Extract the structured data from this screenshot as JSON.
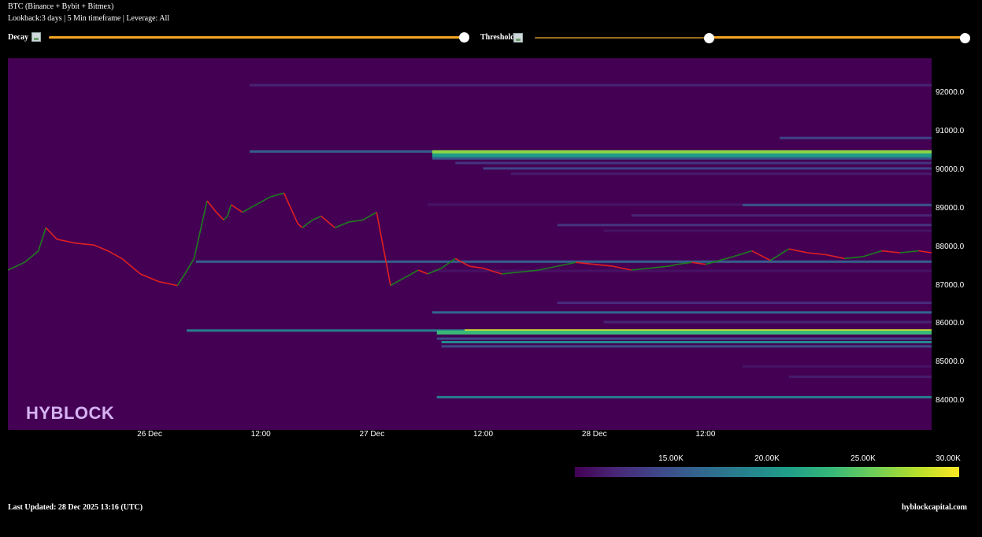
{
  "header": {
    "title": "BTC (Binance + Bybit + Bitmex)",
    "subtitle": "Lookback:3 days | 5 Min timeframe | Leverage: All"
  },
  "controls": {
    "decay": {
      "label": "Decay",
      "value": 1.0
    },
    "threshold": {
      "label": "Threshold",
      "range": [
        0.4,
        1.0
      ]
    }
  },
  "colors": {
    "background": "#000000",
    "heatmap_bg": "#440154",
    "slider": "#f5a623",
    "candle_up": "#1e7d1e",
    "candle_down": "#e02020"
  },
  "footer": {
    "updated": "Last Updated: 28 Dec 2025 13:16 (UTC)",
    "site": "hyblockcapital.com"
  },
  "watermark": "HYBLOCK",
  "chart_data": {
    "type": "heatmap",
    "title": "BTC (Binance + Bybit + Bitmex)",
    "x_ticks": [
      "26 Dec",
      "12:00",
      "27 Dec",
      "12:00",
      "28 Dec",
      "12:00"
    ],
    "y_ticks": [
      "92000.0",
      "91000.0",
      "90000.0",
      "89000.0",
      "88000.0",
      "87000.0",
      "86000.0",
      "85000.0",
      "84000.0"
    ],
    "ylim": [
      83250,
      92900
    ],
    "xlim_hours": [
      -39.3,
      60.4
    ],
    "colorbar": {
      "ticks": [
        "15.00K",
        "20.00K",
        "25.00K",
        "30.00K"
      ],
      "range": [
        10000,
        30000
      ]
    },
    "price_series": {
      "hours": [
        -39.3,
        -37.5,
        -36,
        -35.2,
        -34,
        -32,
        -30,
        -28.5,
        -27,
        -25,
        -23,
        -21,
        -20.2,
        -19.2,
        -17.8,
        -16.8,
        -16,
        -15.6,
        -15.2,
        -14,
        -12.5,
        -11,
        -9.5,
        -8,
        -7.5,
        -7,
        -6.4,
        -5.5,
        -4,
        -2.5,
        -1,
        0.5,
        2,
        3.5,
        5,
        6,
        7.5,
        9,
        10.5,
        12,
        14,
        16,
        18,
        20,
        22,
        24,
        26,
        28,
        30,
        32,
        33,
        34.5,
        36,
        37.5,
        39,
        41,
        43,
        45,
        47,
        49,
        51,
        53,
        55,
        57,
        59,
        60.4
      ],
      "values": [
        87400,
        87600,
        87900,
        88500,
        88200,
        88100,
        88050,
        87900,
        87700,
        87300,
        87100,
        87000,
        87300,
        87700,
        89200,
        88900,
        88700,
        88800,
        89100,
        88900,
        89100,
        89300,
        89400,
        88600,
        88500,
        88600,
        88700,
        88800,
        88500,
        88650,
        88700,
        88900,
        87000,
        87200,
        87400,
        87300,
        87450,
        87700,
        87500,
        87450,
        87300,
        87350,
        87400,
        87500,
        87600,
        87550,
        87500,
        87400,
        87450,
        87500,
        87550,
        87600,
        87550,
        87650,
        87750,
        87900,
        87650,
        87950,
        87850,
        87800,
        87700,
        87750,
        87900,
        87850,
        87900,
        87850
      ]
    },
    "liquidity_bands": [
      {
        "price": 92200,
        "start_h": -13.2,
        "value": 12000
      },
      {
        "price": 90830,
        "start_h": 44,
        "value": 14000
      },
      {
        "price": 90480,
        "start_h": -13.2,
        "value": 16000
      },
      {
        "price": 90460,
        "start_h": 6.5,
        "value": 26500
      },
      {
        "price": 90380,
        "start_h": 6.5,
        "value": 21000
      },
      {
        "price": 90300,
        "start_h": 6.5,
        "value": 15500
      },
      {
        "price": 90180,
        "start_h": 9,
        "value": 13000
      },
      {
        "price": 90040,
        "start_h": 12,
        "value": 14000
      },
      {
        "price": 89900,
        "start_h": 15,
        "value": 11500
      },
      {
        "price": 89100,
        "start_h": 6,
        "value": 11000
      },
      {
        "price": 89090,
        "start_h": 40,
        "value": 15000
      },
      {
        "price": 88820,
        "start_h": 28,
        "value": 12000
      },
      {
        "price": 88570,
        "start_h": 20,
        "value": 13000
      },
      {
        "price": 88420,
        "start_h": 25,
        "value": 11000
      },
      {
        "price": 87620,
        "start_h": -19,
        "value": 16000
      },
      {
        "price": 87380,
        "start_h": 6.5,
        "value": 11000
      },
      {
        "price": 86550,
        "start_h": 20,
        "value": 12500
      },
      {
        "price": 86300,
        "start_h": 6.5,
        "value": 16500
      },
      {
        "price": 86050,
        "start_h": 25,
        "value": 12000
      },
      {
        "price": 85830,
        "start_h": -20,
        "value": 18500
      },
      {
        "price": 85810,
        "start_h": 10,
        "value": 29500
      },
      {
        "price": 85780,
        "start_h": 7,
        "value": 23500
      },
      {
        "price": 85620,
        "start_h": 7,
        "value": 14500
      },
      {
        "price": 85530,
        "start_h": 7.5,
        "value": 19500
      },
      {
        "price": 85420,
        "start_h": 7.5,
        "value": 14500
      },
      {
        "price": 84900,
        "start_h": 40,
        "value": 11000
      },
      {
        "price": 84630,
        "start_h": 45,
        "value": 11500
      },
      {
        "price": 84100,
        "start_h": 7,
        "value": 18500
      }
    ]
  }
}
